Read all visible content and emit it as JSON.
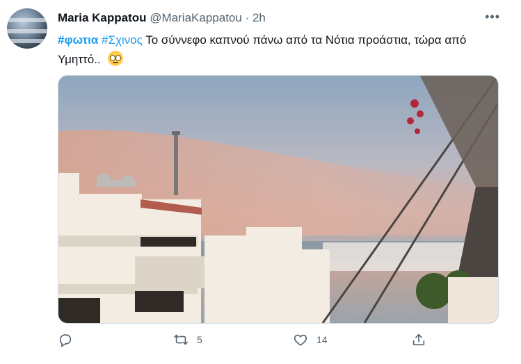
{
  "author": {
    "name": "Maria Kappatou",
    "handle": "@MariaKappatou",
    "separator": "·",
    "time": "2h"
  },
  "more_label": "•••",
  "tweet": {
    "hashtag1": "#φωτια",
    "hashtag2": "#Σχινος",
    "text": " Το σύννεφο καπνού πάνω από τα Νότια προάστια, τώρα από Υμηττό.. "
  },
  "media": {
    "description_icon": "photo"
  },
  "actions": {
    "reply_count": "",
    "retweet_count": "5",
    "like_count": "14"
  },
  "colors": {
    "accent": "#1d9bf0",
    "muted": "#536471"
  }
}
